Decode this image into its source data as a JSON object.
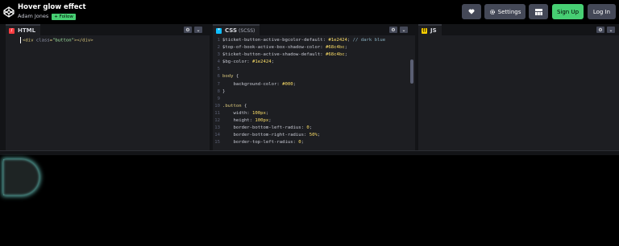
{
  "header": {
    "title": "Hover glow effect",
    "author": "Adam Jones",
    "follow_label": "+ Follow",
    "settings_label": "Settings",
    "signup_label": "Sign Up",
    "login_label": "Log In",
    "icons": {
      "logo": "codepen-logo-icon",
      "heart": "heart-icon",
      "settings": "gear-icon",
      "layout": "layout-icon"
    }
  },
  "editors": {
    "html": {
      "label": "HTML",
      "lines": [
        {
          "n": "",
          "parts": [
            [
              "tag",
              "<div "
            ],
            [
              "attr",
              "class"
            ],
            [
              "tag",
              "="
            ],
            [
              "val",
              "\"button\""
            ],
            [
              "tag",
              "></div>"
            ]
          ]
        }
      ]
    },
    "css": {
      "label": "CSS",
      "sublabel": "(SCSS)",
      "lines": [
        {
          "n": "1",
          "parts": [
            [
              "c-var",
              "$ticket-button-active-bgcolor-default: "
            ],
            [
              "c-num",
              "#1e2424"
            ],
            [
              "c-var",
              "; "
            ],
            [
              "c-cmt",
              "// dark blue"
            ]
          ]
        },
        {
          "n": "2",
          "parts": [
            [
              "c-var",
              "$top-of-book-active-box-shadow-color: "
            ],
            [
              "c-num",
              "#68c4bc"
            ],
            [
              "c-var",
              ";"
            ]
          ]
        },
        {
          "n": "3",
          "parts": [
            [
              "c-var",
              "$ticket-button-active-shadow-default: "
            ],
            [
              "c-num",
              "#68c4bc"
            ],
            [
              "c-var",
              ";"
            ]
          ]
        },
        {
          "n": "4",
          "parts": [
            [
              "c-var",
              "$bg-color: "
            ],
            [
              "c-num",
              "#1e2424"
            ],
            [
              "c-var",
              ";"
            ]
          ]
        },
        {
          "n": "5",
          "parts": []
        },
        {
          "n": "6",
          "parts": [
            [
              "c-sel",
              "body "
            ],
            [
              "c-var",
              "{"
            ]
          ]
        },
        {
          "n": "7",
          "parts": [
            [
              "c-prop",
              "    background-color: "
            ],
            [
              "c-num",
              "#000"
            ],
            [
              "c-var",
              ";"
            ]
          ]
        },
        {
          "n": "8",
          "parts": [
            [
              "c-var",
              "}"
            ]
          ]
        },
        {
          "n": "9",
          "parts": []
        },
        {
          "n": "10",
          "parts": [
            [
              "c-sel",
              ".button "
            ],
            [
              "c-var",
              "{"
            ]
          ]
        },
        {
          "n": "11",
          "parts": [
            [
              "c-prop",
              "    width: "
            ],
            [
              "c-num",
              "100px"
            ],
            [
              "c-var",
              ";"
            ]
          ]
        },
        {
          "n": "12",
          "parts": [
            [
              "c-prop",
              "    height: "
            ],
            [
              "c-num",
              "100px"
            ],
            [
              "c-var",
              ";"
            ]
          ]
        },
        {
          "n": "13",
          "parts": [
            [
              "c-prop",
              "    border-bottom-left-radius: "
            ],
            [
              "c-num",
              "0"
            ],
            [
              "c-var",
              ";"
            ]
          ]
        },
        {
          "n": "14",
          "parts": [
            [
              "c-prop",
              "    border-bottom-right-radius: "
            ],
            [
              "c-num",
              "50%"
            ],
            [
              "c-var",
              ";"
            ]
          ]
        },
        {
          "n": "15",
          "parts": [
            [
              "c-prop",
              "    border-top-left-radius: "
            ],
            [
              "c-num",
              "0"
            ],
            [
              "c-var",
              ";"
            ]
          ]
        }
      ]
    },
    "js": {
      "label": "JS"
    }
  },
  "colors": {
    "accent_green": "#47cf73",
    "button_bg": "#1e2424",
    "glow": "#68c4bc",
    "html_icon": "#ff3c41",
    "css_icon": "#0ebeff",
    "js_icon": "#fcd000"
  }
}
